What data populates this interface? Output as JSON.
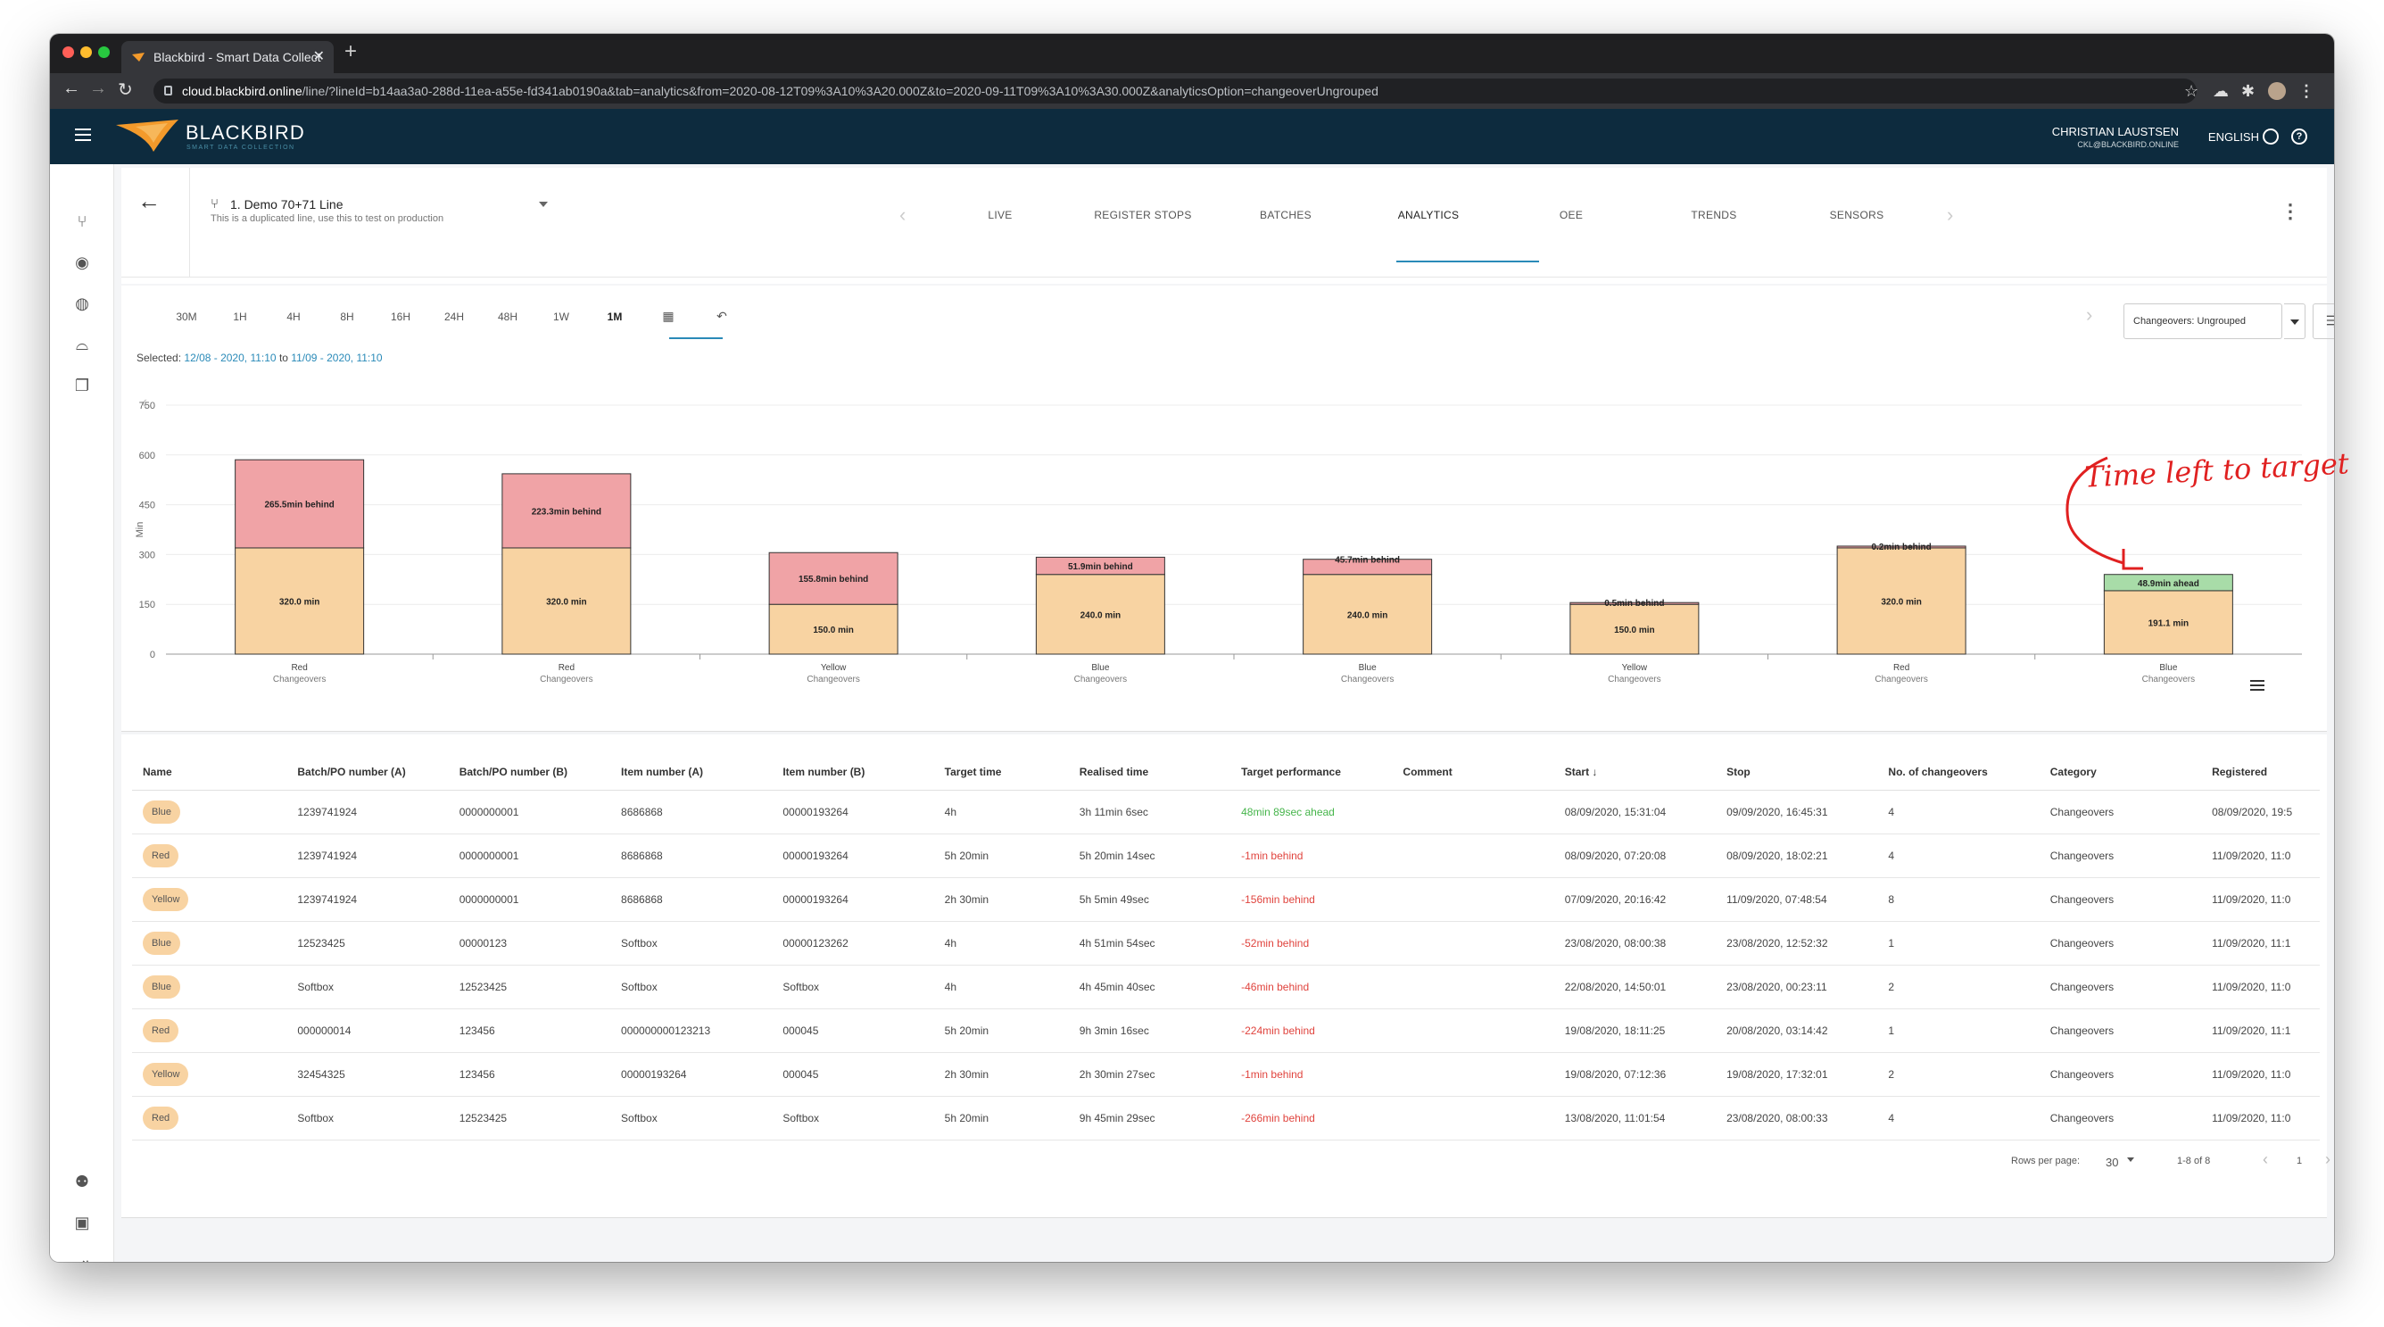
{
  "browser": {
    "tab_title": "Blackbird - Smart Data Collect",
    "url_host": "cloud.blackbird.online",
    "url_path": "/line/?lineId=b14aa3a0-288d-11ea-a55e-fd341ab0190a&tab=analytics&from=2020-08-12T09%3A10%3A20.000Z&to=2020-09-11T09%3A10%3A30.000Z&analyticsOption=changeoverUngrouped"
  },
  "header": {
    "logo": "BLACKBIRD",
    "logo_sub": "SMART DATA COLLECTION",
    "user_name": "CHRISTIAN LAUSTSEN",
    "user_email": "CKL@BLACKBIRD.ONLINE",
    "language": "ENGLISH"
  },
  "line": {
    "title": "1. Demo 70+71 Line",
    "subtitle": "This is a duplicated line, use this to test on production"
  },
  "tabs": [
    "LIVE",
    "REGISTER STOPS",
    "BATCHES",
    "ANALYTICS",
    "OEE",
    "TRENDS",
    "SENSORS"
  ],
  "active_tab": "ANALYTICS",
  "time_ranges": [
    "30M",
    "1H",
    "4H",
    "8H",
    "16H",
    "24H",
    "48H",
    "1W",
    "1M"
  ],
  "active_range": "1M",
  "selected": {
    "label": "Selected:",
    "from": "12/08 - 2020, 11:10",
    "to_word": "to",
    "to": "11/09 - 2020, 11:10"
  },
  "changeover_select": "Changeovers: Ungrouped",
  "annotation": "Time left to target",
  "colors": {
    "realised": "#f8d3a2",
    "behind": "#f0a3a6",
    "ahead": "#a8dca8",
    "accent": "#2a8ab8",
    "header_bg": "#0d2b3e"
  },
  "chart_data": {
    "type": "bar",
    "stacked": true,
    "ylabel": "Min",
    "ylim": [
      0,
      750
    ],
    "yticks": [
      0,
      150,
      300,
      450,
      600,
      750
    ],
    "categories": [
      {
        "name": "Red",
        "sub": "Changeovers"
      },
      {
        "name": "Red",
        "sub": "Changeovers"
      },
      {
        "name": "Yellow",
        "sub": "Changeovers"
      },
      {
        "name": "Blue",
        "sub": "Changeovers"
      },
      {
        "name": "Blue",
        "sub": "Changeovers"
      },
      {
        "name": "Yellow",
        "sub": "Changeovers"
      },
      {
        "name": "Red",
        "sub": "Changeovers"
      },
      {
        "name": "Blue",
        "sub": "Changeovers"
      }
    ],
    "base_values": [
      320.0,
      320.0,
      150.0,
      240.0,
      240.0,
      150.0,
      320.0,
      191.1
    ],
    "base_labels": [
      "320.0 min",
      "320.0 min",
      "150.0 min",
      "240.0 min",
      "240.0 min",
      "150.0 min",
      "320.0 min",
      "191.1 min"
    ],
    "delta_values": [
      265.5,
      223.3,
      155.8,
      51.9,
      45.7,
      0.5,
      0.2,
      48.9
    ],
    "delta_status": [
      "behind",
      "behind",
      "behind",
      "behind",
      "behind",
      "behind",
      "behind",
      "ahead"
    ],
    "delta_labels": [
      "265.5min behind",
      "223.3min behind",
      "155.8min behind",
      "51.9min behind",
      "45.7min behind",
      "0.5min behind",
      "0.2min behind",
      "48.9min ahead"
    ]
  },
  "table": {
    "columns": [
      "Name",
      "Batch/PO number (A)",
      "Batch/PO number (B)",
      "Item number (A)",
      "Item number (B)",
      "Target time",
      "Realised time",
      "Target performance",
      "Comment",
      "Start ↓",
      "Stop",
      "No. of changeovers",
      "Category",
      "Registered"
    ],
    "rows": [
      {
        "name": "Blue",
        "batch_a": "1239741924",
        "batch_b": "0000000001",
        "item_a": "8686868",
        "item_b": "00000193264",
        "target": "4h",
        "realised": "3h 11min 6sec",
        "perf": "48min 89sec ahead",
        "status": "ahead",
        "comment": "",
        "start": "08/09/2020, 15:31:04",
        "stop": "09/09/2020, 16:45:31",
        "count": "4",
        "category": "Changeovers",
        "registered": "08/09/2020, 19:5"
      },
      {
        "name": "Red",
        "batch_a": "1239741924",
        "batch_b": "0000000001",
        "item_a": "8686868",
        "item_b": "00000193264",
        "target": "5h 20min",
        "realised": "5h 20min 14sec",
        "perf": "-1min behind",
        "status": "behind",
        "comment": "",
        "start": "08/09/2020, 07:20:08",
        "stop": "08/09/2020, 18:02:21",
        "count": "4",
        "category": "Changeovers",
        "registered": "11/09/2020, 11:0"
      },
      {
        "name": "Yellow",
        "batch_a": "1239741924",
        "batch_b": "0000000001",
        "item_a": "8686868",
        "item_b": "00000193264",
        "target": "2h 30min",
        "realised": "5h 5min 49sec",
        "perf": "-156min behind",
        "status": "behind",
        "comment": "",
        "start": "07/09/2020, 20:16:42",
        "stop": "11/09/2020, 07:48:54",
        "count": "8",
        "category": "Changeovers",
        "registered": "11/09/2020, 11:0"
      },
      {
        "name": "Blue",
        "batch_a": "12523425",
        "batch_b": "00000123",
        "item_a": "Softbox",
        "item_b": "00000123262",
        "target": "4h",
        "realised": "4h 51min 54sec",
        "perf": "-52min behind",
        "status": "behind",
        "comment": "",
        "start": "23/08/2020, 08:00:38",
        "stop": "23/08/2020, 12:52:32",
        "count": "1",
        "category": "Changeovers",
        "registered": "11/09/2020, 11:1"
      },
      {
        "name": "Blue",
        "batch_a": "Softbox",
        "batch_b": "12523425",
        "item_a": "Softbox",
        "item_b": "Softbox",
        "target": "4h",
        "realised": "4h 45min 40sec",
        "perf": "-46min behind",
        "status": "behind",
        "comment": "",
        "start": "22/08/2020, 14:50:01",
        "stop": "23/08/2020, 00:23:11",
        "count": "2",
        "category": "Changeovers",
        "registered": "11/09/2020, 11:0"
      },
      {
        "name": "Red",
        "batch_a": "000000014",
        "batch_b": "123456",
        "item_a": "000000000123213",
        "item_b": "000045",
        "target": "5h 20min",
        "realised": "9h 3min 16sec",
        "perf": "-224min behind",
        "status": "behind",
        "comment": "",
        "start": "19/08/2020, 18:11:25",
        "stop": "20/08/2020, 03:14:42",
        "count": "1",
        "category": "Changeovers",
        "registered": "11/09/2020, 11:1"
      },
      {
        "name": "Yellow",
        "batch_a": "32454325",
        "batch_b": "123456",
        "item_a": "00000193264",
        "item_b": "000045",
        "target": "2h 30min",
        "realised": "2h 30min 27sec",
        "perf": "-1min behind",
        "status": "behind",
        "comment": "",
        "start": "19/08/2020, 07:12:36",
        "stop": "19/08/2020, 17:32:01",
        "count": "2",
        "category": "Changeovers",
        "registered": "11/09/2020, 11:0"
      },
      {
        "name": "Red",
        "batch_a": "Softbox",
        "batch_b": "12523425",
        "item_a": "Softbox",
        "item_b": "Softbox",
        "target": "5h 20min",
        "realised": "9h 45min 29sec",
        "perf": "-266min behind",
        "status": "behind",
        "comment": "",
        "start": "13/08/2020, 11:01:54",
        "stop": "23/08/2020, 08:00:33",
        "count": "4",
        "category": "Changeovers",
        "registered": "11/09/2020, 11:0"
      }
    ]
  },
  "pagination": {
    "rows_label": "Rows per page:",
    "rows_value": "30",
    "range": "1-8 of 8",
    "page": "1"
  }
}
